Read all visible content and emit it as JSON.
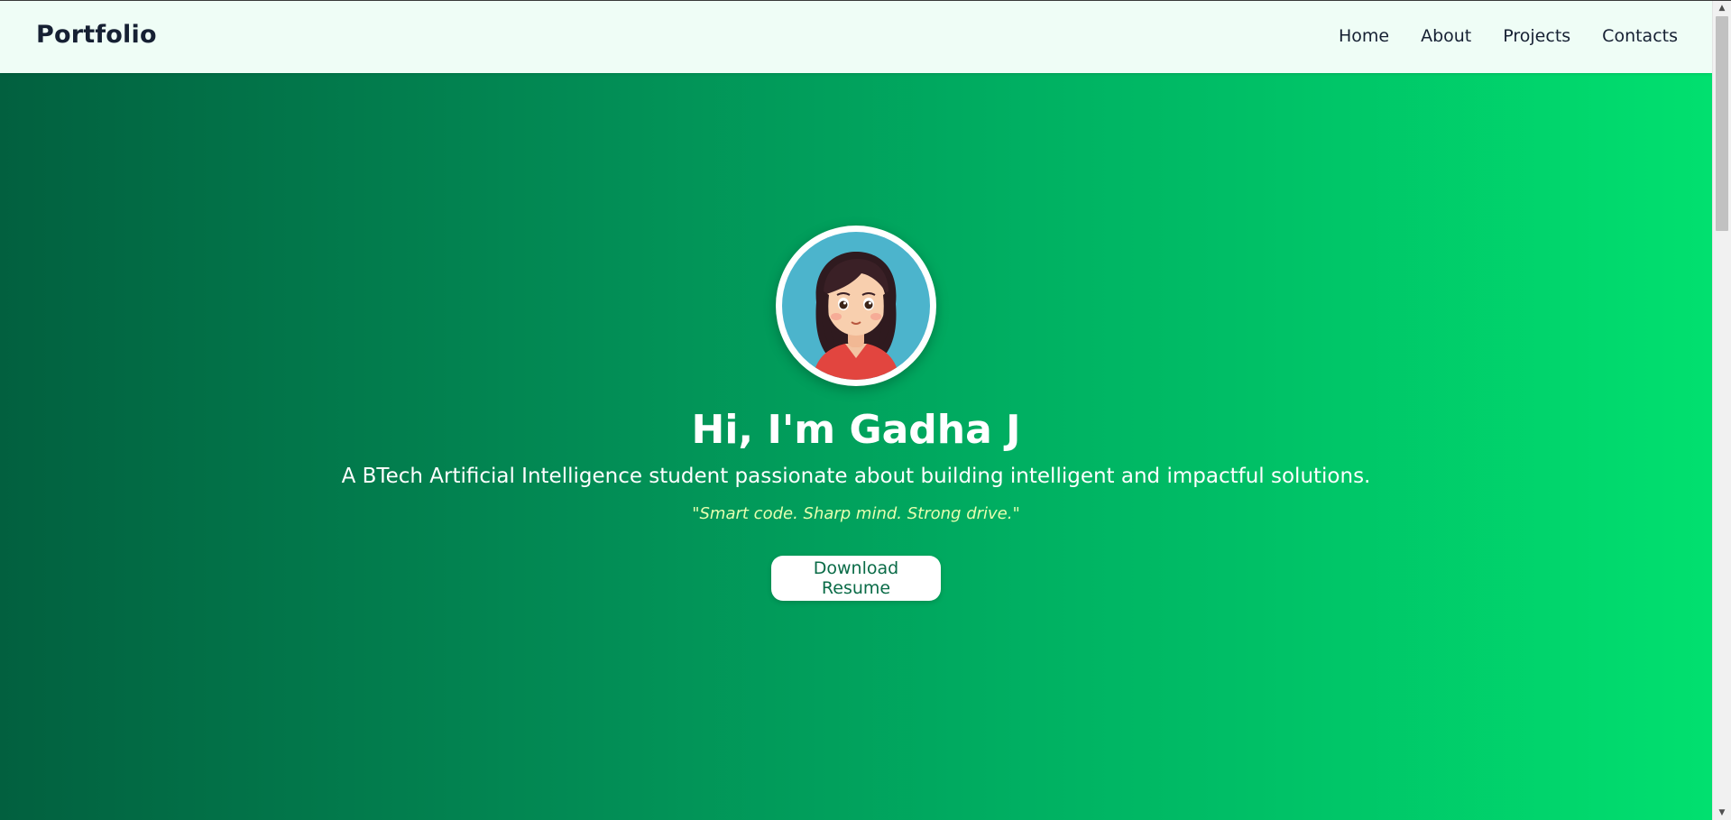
{
  "navbar": {
    "brand": "Portfolio",
    "links": [
      {
        "label": "Home"
      },
      {
        "label": "About"
      },
      {
        "label": "Projects"
      },
      {
        "label": "Contacts"
      }
    ]
  },
  "hero": {
    "avatar_icon": "avatar-girl-illustration",
    "title": "Hi, I'm Gadha J",
    "subtitle": "A BTech Artificial Intelligence student passionate about building intelligent and impactful solutions.",
    "quote": "\"Smart code. Sharp mind. Strong drive.\"",
    "button_label": "Download Resume"
  },
  "colors": {
    "nav_background": "#effdf6",
    "gradient_start": "#02603f",
    "gradient_end": "#01e06f",
    "quote_text": "#e6ffb0",
    "button_text": "#0a6b47"
  },
  "scrollbar": {
    "up_icon": "triangle-up-icon",
    "down_icon": "triangle-down-icon"
  }
}
